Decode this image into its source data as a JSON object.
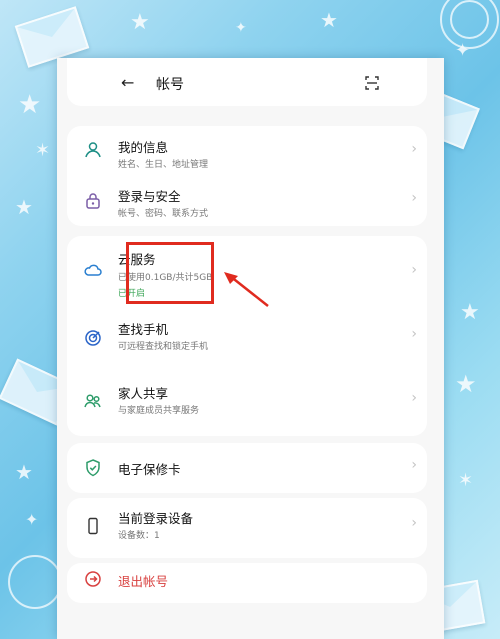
{
  "header": {
    "back_icon": "arrow-left-icon",
    "title": "帐号",
    "scan_icon": "scan-icon"
  },
  "rows": [
    {
      "label": "我的信息",
      "sub": "姓名、生日、地址管理",
      "icon": "person-icon"
    },
    {
      "label": "登录与安全",
      "sub": "帐号、密码、联系方式",
      "icon": "lock-icon"
    },
    {
      "label": "云服务",
      "sub": "已使用0.1GB/共计5GB",
      "status": "已开启",
      "icon": "cloud-icon"
    },
    {
      "label": "查找手机",
      "sub": "可远程查找和锁定手机",
      "icon": "target-icon"
    },
    {
      "label": "家人共享",
      "sub": "与家庭成员共享服务",
      "icon": "family-icon"
    },
    {
      "label": "电子保修卡",
      "icon": "shield-icon"
    },
    {
      "label": "当前登录设备",
      "sub": "设备数：1",
      "icon": "phone-icon"
    }
  ],
  "logout": {
    "label": "退出帐号",
    "icon": "logout-icon"
  },
  "colors": {
    "annotation": "#e02b1f",
    "status_green": "#3ea659",
    "logout_red": "#d8403f",
    "icon_teal": "#1f8f86"
  }
}
